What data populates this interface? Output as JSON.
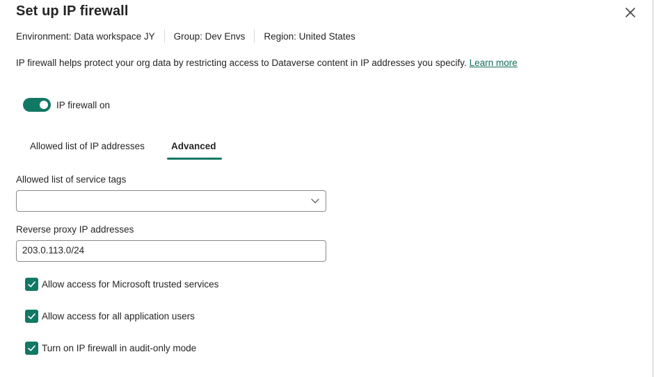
{
  "dialog": {
    "title": "Set up IP firewall",
    "close_icon": "close-icon"
  },
  "meta": {
    "environment": "Environment: Data workspace JY",
    "group": "Group: Dev Envs",
    "region": "Region: United States"
  },
  "description": {
    "text": "IP firewall helps protect your org data by restricting access to Dataverse content in IP addresses you specify.",
    "link": "Learn more"
  },
  "toggle": {
    "label": "IP firewall on",
    "state": "on"
  },
  "tabs": [
    {
      "label": "Allowed list of IP addresses",
      "selected": false
    },
    {
      "label": "Advanced",
      "selected": true
    }
  ],
  "service_tags": {
    "label": "Allowed list of service tags",
    "value": "",
    "icon": "chevron-down-icon"
  },
  "reverse_proxy": {
    "label": "Reverse proxy IP addresses",
    "value": "203.0.113.0/24"
  },
  "checkboxes": [
    {
      "label": "Allow access for Microsoft trusted services",
      "checked": true
    },
    {
      "label": "Allow access for all application users",
      "checked": true
    },
    {
      "label": "Turn on IP firewall in audit-only mode",
      "checked": true
    }
  ],
  "colors": {
    "accent": "#117865",
    "link": "#0f6e5a"
  }
}
